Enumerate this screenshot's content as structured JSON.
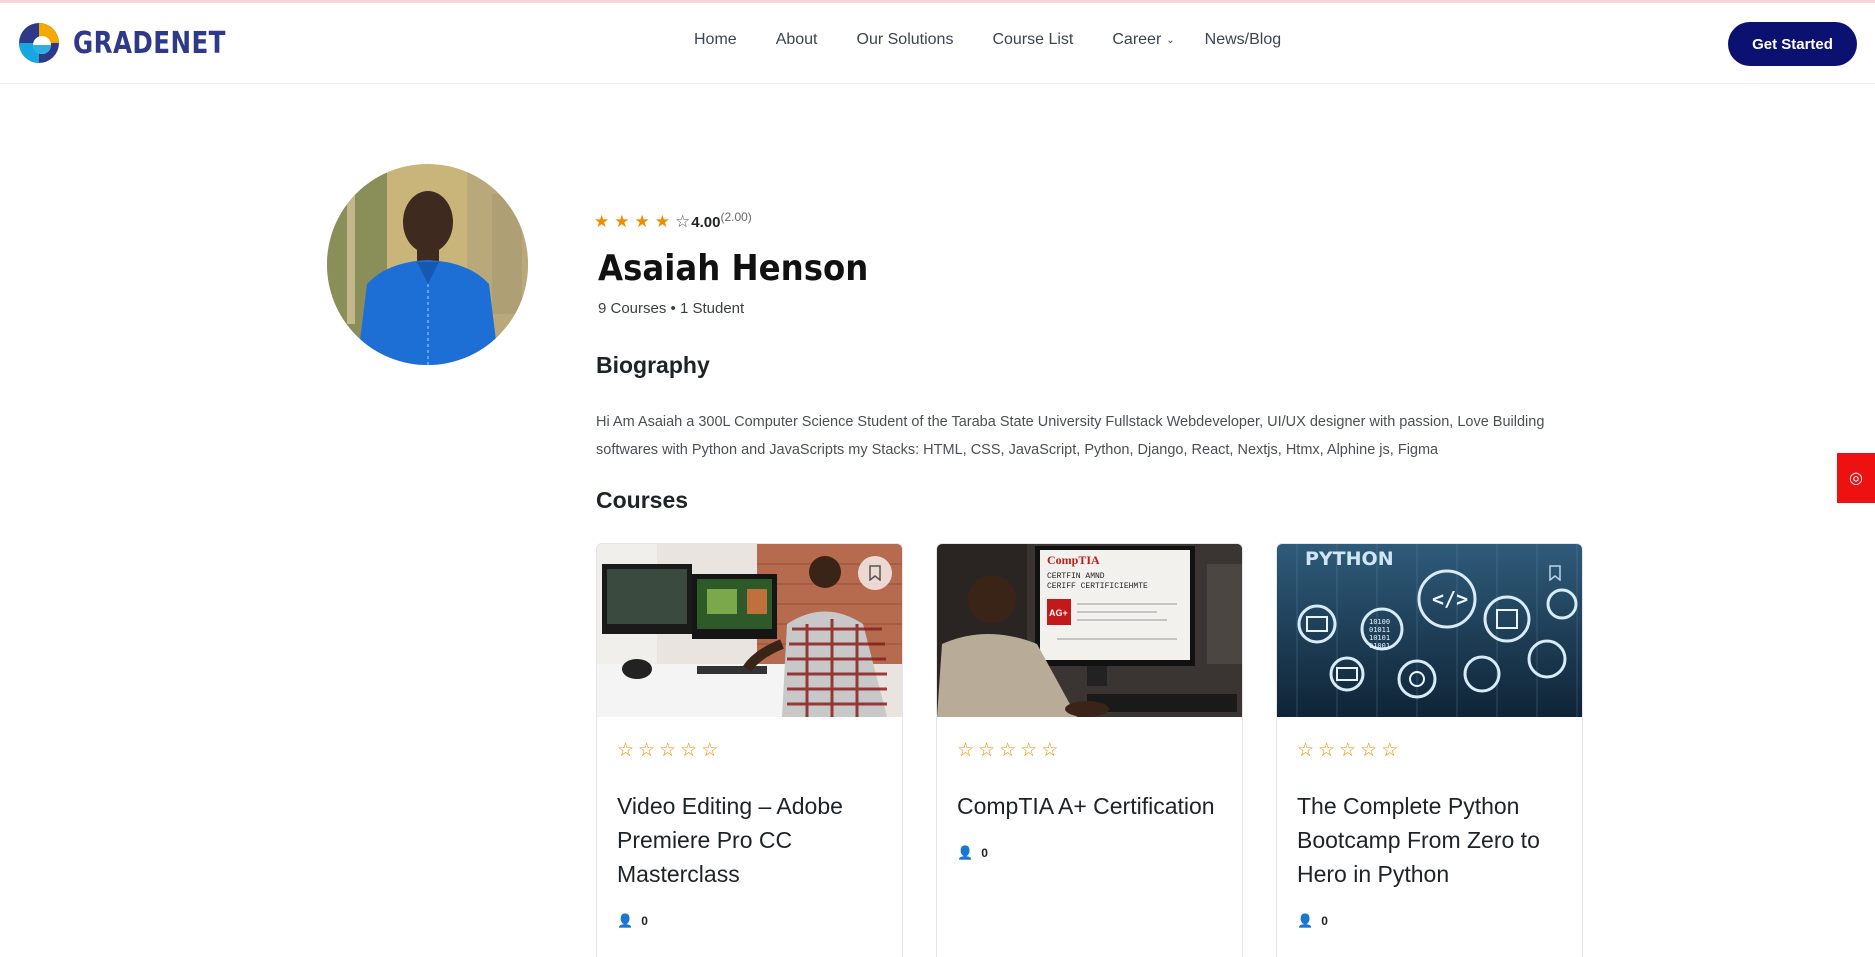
{
  "brand": {
    "name": "GRADENET"
  },
  "nav": {
    "items": [
      {
        "label": "Home"
      },
      {
        "label": "About"
      },
      {
        "label": "Our Solutions"
      },
      {
        "label": "Course List"
      },
      {
        "label": "Career"
      },
      {
        "label": "News/Blog"
      }
    ],
    "cta_label": "Get Started"
  },
  "profile": {
    "rating_value": "4.00",
    "rating_count": "(2.00)",
    "stars_filled": 4,
    "stars_total": 5,
    "name": "Asaiah Henson",
    "meta": "9 Courses • 1 Student",
    "bio_heading": "Biography",
    "bio_text": "Hi Am Asaiah a 300L Computer Science Student of the Taraba State University Fullstack Webdeveloper, UI/UX designer with passion, Love Building softwares with Python and JavaScripts my Stacks: HTML, CSS, JavaScript, Python, Django, React, Nextjs, Htmx, Alphine js, Figma"
  },
  "courses": {
    "heading": "Courses",
    "items": [
      {
        "title": "Video Editing – Adobe Premiere Pro CC Masterclass",
        "enrolled": "0"
      },
      {
        "title": "CompTIA A+ Certification",
        "enrolled": "0"
      },
      {
        "title": "The Complete Python Bootcamp From Zero to Hero in Python",
        "enrolled": "0"
      }
    ]
  },
  "thumb_text": {
    "comptia_brand": "CompTIA",
    "comptia_line1": "CERTFIN  AMND",
    "comptia_line2": "CERIFF  CERTIFICIEHMTE",
    "comptia_badge": "AG+",
    "python_banner": "PYTHON",
    "python_code": "</>",
    "python_bits": [
      "10100",
      "01011",
      "10101",
      "01001"
    ]
  },
  "colors": {
    "accent": "#0b1170",
    "star": "#f08c00",
    "side_tab": "#ee1111"
  }
}
